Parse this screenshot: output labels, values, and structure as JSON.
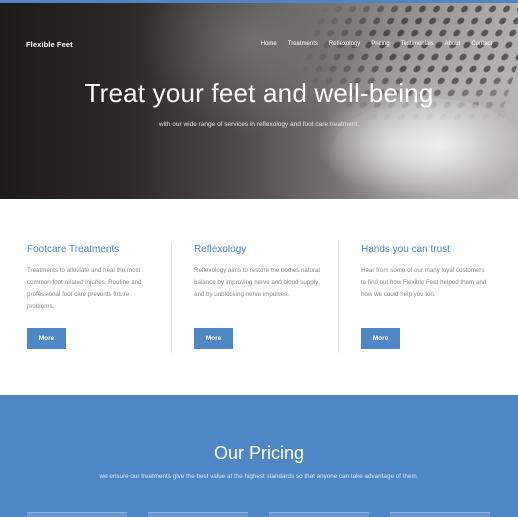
{
  "brand": "Flexible Feet",
  "nav": [
    "Home",
    "Treatments",
    "Reflexology",
    "Pricing",
    "Testimonials",
    "About",
    "Contact"
  ],
  "hero": {
    "title": "Treat your feet and well-being",
    "subtitle": "with our wide range of services in reflexology and foot care treatment."
  },
  "features": [
    {
      "title": "Footcare Treatments",
      "text": "Treatments to alleviate and heal the most common foot related injuries. Routine and professional foot care prevents future problems.",
      "button": "More"
    },
    {
      "title": "Reflexology",
      "text": "Reflexology aims to restore the bodies natural balance by improving nerve and blood supply and by unblocking nerve impulses.",
      "button": "More"
    },
    {
      "title": "Hands you can trust",
      "text": "Hear from some of our many loyal customers to find out how Flexible Feet helped them and how we could help you too.",
      "button": "More"
    }
  ],
  "pricing": {
    "title": "Our Pricing",
    "subtitle": "we ensure our treatments give the best value at the highest standards so that anyone can take advantage of them."
  },
  "colors": {
    "accent": "#4f86c6",
    "heading_blue": "#4f86c6",
    "body_text": "#8a8a8a"
  }
}
